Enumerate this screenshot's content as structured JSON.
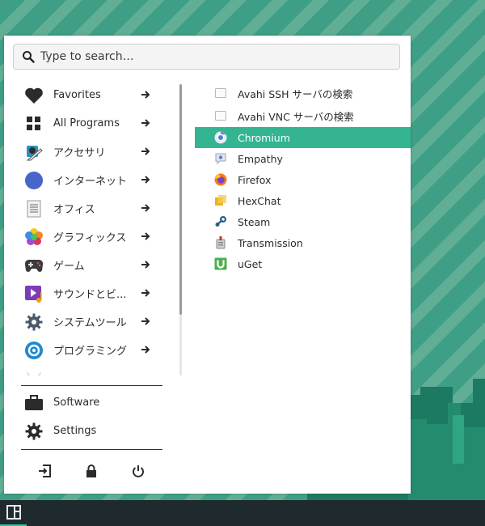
{
  "search": {
    "placeholder": "Type to search…"
  },
  "categories": [
    {
      "label": "Favorites",
      "icon": "heart-icon"
    },
    {
      "label": "All Programs",
      "icon": "grid-icon"
    },
    {
      "label": "アクセサリ",
      "icon": "accessories-icon"
    },
    {
      "label": "インターネット",
      "icon": "compass-icon"
    },
    {
      "label": "オフィス",
      "icon": "document-icon"
    },
    {
      "label": "グラフィックス",
      "icon": "graphics-icon"
    },
    {
      "label": "ゲーム",
      "icon": "gamepad-icon"
    },
    {
      "label": "サウンドとビ...",
      "icon": "multimedia-icon"
    },
    {
      "label": "システムツール",
      "icon": "gear-icon"
    },
    {
      "label": "プログラミング",
      "icon": "programming-icon"
    }
  ],
  "places": [
    {
      "label": "Software",
      "icon": "briefcase-icon"
    },
    {
      "label": "Settings",
      "icon": "settings-icon"
    }
  ],
  "apps": [
    {
      "label": "Avahi SSH サーバの検索",
      "icon": "window-icon"
    },
    {
      "label": "Avahi VNC サーバの検索",
      "icon": "window-icon"
    },
    {
      "label": "Chromium",
      "icon": "chromium-icon",
      "selected": true
    },
    {
      "label": "Empathy",
      "icon": "empathy-icon"
    },
    {
      "label": "Firefox",
      "icon": "firefox-icon"
    },
    {
      "label": "HexChat",
      "icon": "hexchat-icon"
    },
    {
      "label": "Steam",
      "icon": "steam-icon"
    },
    {
      "label": "Transmission",
      "icon": "transmission-icon"
    },
    {
      "label": "uGet",
      "icon": "uget-icon"
    }
  ],
  "session_actions": [
    "logout-icon",
    "lock-icon",
    "power-icon"
  ],
  "colors": {
    "accent": "#35b492",
    "taskbar": "#1f2a2e",
    "desktop": "#3a9f86"
  }
}
